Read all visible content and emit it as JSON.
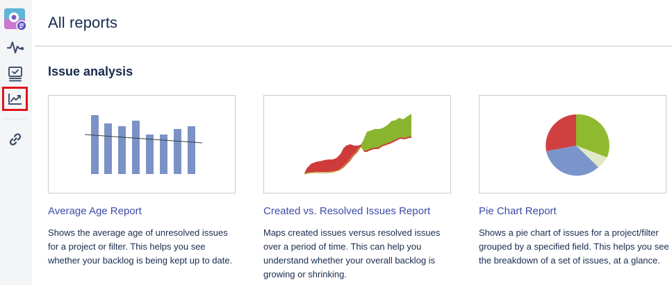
{
  "header": {
    "title": "All reports"
  },
  "section": {
    "title": "Issue analysis"
  },
  "cards": [
    {
      "title": "Average Age Report",
      "description": "Shows the average age of unresolved issues for a project or filter. This helps you see whether your backlog is being kept up to date."
    },
    {
      "title": "Created vs. Resolved Issues Report",
      "description": "Maps created issues versus resolved issues over a period of time. This can help you understand whether your overall backlog is growing or shrinking."
    },
    {
      "title": "Pie Chart Report",
      "description": "Shows a pie chart of issues for a project/filter grouped by a specified field. This helps you see the breakdown of a set of issues, at a glance."
    }
  ],
  "sidebar": {
    "items": [
      {
        "icon": "project-avatar-icon"
      },
      {
        "icon": "activity-icon"
      },
      {
        "icon": "board-icon"
      },
      {
        "icon": "reports-icon",
        "selected": true
      },
      {
        "icon": "link-icon"
      }
    ]
  },
  "colors": {
    "bar_blue": "#7b92c6",
    "created_red": "#cf3b3b",
    "resolved_green": "#8ab52e",
    "pie_red": "#d04040",
    "pie_green": "#8fba30",
    "pie_light": "#dfe9c7",
    "pie_blue": "#7b95cc",
    "highlight": "#e0121a",
    "link": "#3d4ba8"
  }
}
